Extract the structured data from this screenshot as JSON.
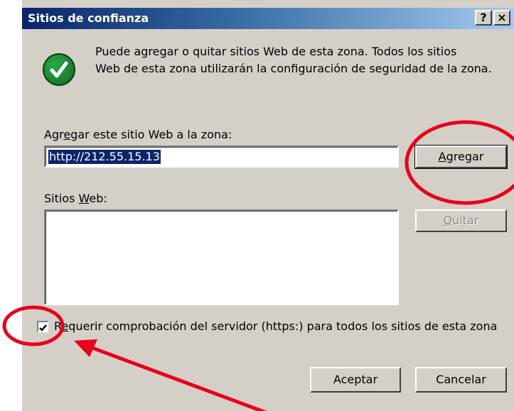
{
  "window": {
    "title": "Sitios de confianza",
    "help_label": "?",
    "close_label": "×"
  },
  "info": {
    "line1": "Puede agregar o quitar sitios Web de esta zona.  Todos los sitios",
    "line2": "Web de esta zona utilizarán la configuración de seguridad de la zona."
  },
  "add_site": {
    "label_pre": "Agr",
    "label_u": "e",
    "label_post": "gar este sitio Web a la zona:",
    "value": "http://212.55.15.13",
    "button_u": "A",
    "button_rest": "gregar"
  },
  "sites": {
    "label_pre": "Sitios ",
    "label_u": "W",
    "label_post": "eb:",
    "items": [],
    "remove_u": "Q",
    "remove_rest": "uitar"
  },
  "https_check": {
    "checked": true,
    "label_pre": "R",
    "label_u": "e",
    "label_post": "querir comprobación del servidor (https:) para todos los sitios de esta zona"
  },
  "footer": {
    "ok_label": "Aceptar",
    "cancel_label": "Cancelar"
  },
  "annotations": {
    "color": "#e8001c"
  }
}
